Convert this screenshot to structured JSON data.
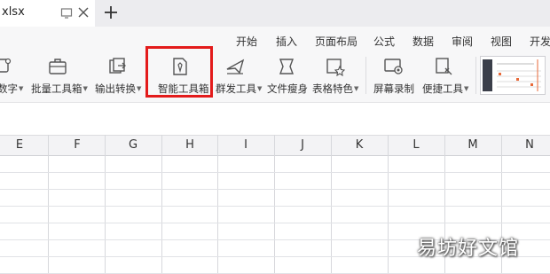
{
  "file_tab": {
    "name": "xlsx"
  },
  "menu": [
    "开始",
    "插入",
    "页面布局",
    "公式",
    "数据",
    "审阅",
    "视图",
    "开发"
  ],
  "toolbar": {
    "items": [
      {
        "label": "数字",
        "icon": "number-icon",
        "dropdown": true
      },
      {
        "label": "批量工具箱",
        "icon": "toolbox-icon",
        "dropdown": true
      },
      {
        "label": "输出转换",
        "icon": "export-icon",
        "dropdown": true
      },
      {
        "label": "智能工具箱",
        "icon": "smart-toolbox-icon",
        "dropdown": false
      },
      {
        "label": "群发工具",
        "icon": "mass-send-icon",
        "dropdown": true
      },
      {
        "label": "文件瘦身",
        "icon": "file-slim-icon",
        "dropdown": false
      },
      {
        "label": "表格特色",
        "icon": "table-features-icon",
        "dropdown": true
      },
      {
        "label": "屏幕录制",
        "icon": "screen-record-icon",
        "dropdown": false
      },
      {
        "label": "便捷工具",
        "icon": "handy-tools-icon",
        "dropdown": true
      }
    ],
    "caret": "▼"
  },
  "columns": [
    "E",
    "F",
    "G",
    "H",
    "I",
    "J",
    "K",
    "L",
    "M",
    "N"
  ],
  "watermark": "易坊好文馆",
  "colors": {
    "highlight": "#e31b1b",
    "toolbar_bg": "#f7f7f8",
    "grid": "#e1e2e6"
  }
}
